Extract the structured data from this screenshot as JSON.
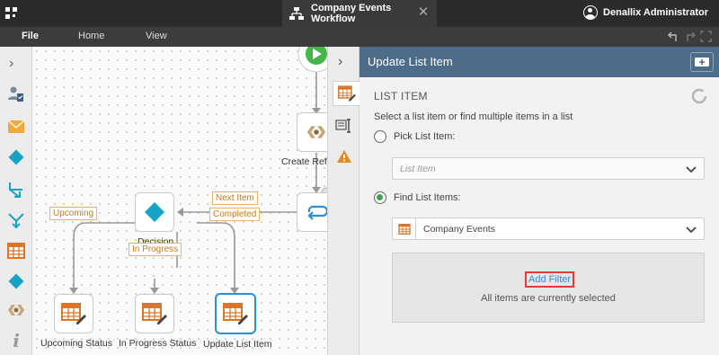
{
  "titlebar": {
    "tab_title": "Company Events Workflow",
    "user_name": "Denallix Administrator"
  },
  "menu": {
    "file": "File",
    "home": "Home",
    "view": "View"
  },
  "toolbox": {
    "icons": [
      "chevron-right-icon",
      "user-task-icon",
      "email-icon",
      "decision-icon",
      "split-icon",
      "merge-icon",
      "list-item-icon",
      "decision-icon",
      "reference-icon",
      "info-icon"
    ]
  },
  "canvas": {
    "nodes": {
      "create_reference": "Create Refe",
      "decision": "Decision",
      "upcoming_status": "Upcoming Status",
      "in_progress_status": "In Progress Status",
      "update_list_item": "Update List Item"
    },
    "tags": {
      "next_item": "Next Item",
      "completed": "Completed",
      "upcoming": "Upcoming",
      "in_progress": "In Progress"
    }
  },
  "panel": {
    "title": "Update List Item",
    "section_title": "LIST ITEM",
    "description": "Select a list item or find multiple items in a list",
    "pick_label": "Pick List Item:",
    "pick_placeholder": "List Item",
    "find_label": "Find List Items:",
    "find_value": "Company Events",
    "add_filter": "Add Filter",
    "filter_note": "All items are currently selected",
    "selected_option": "find"
  },
  "colors": {
    "header_bg": "#4c6c8a",
    "accent_orange": "#d9762b",
    "accent_teal": "#17a3c7",
    "selected_border": "#2d8fd1",
    "start_green": "#45b649",
    "highlight_red": "#e53a3a",
    "link_blue": "#3b8cd6"
  }
}
